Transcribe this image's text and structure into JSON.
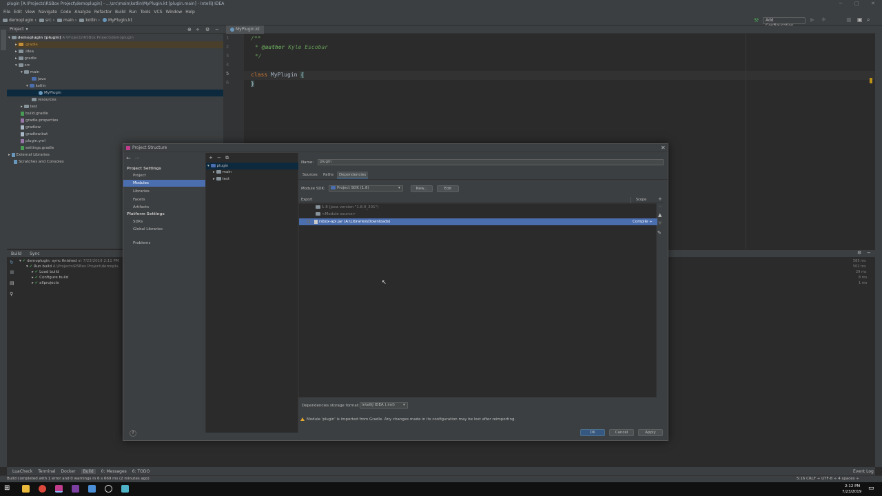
{
  "window": {
    "title": "plugin [A:\\Projects\\RSBox Project\\demoplugin] - ...\\src\\main\\kotlin\\MyPlugin.kt [plugin.main] - IntelliJ IDEA"
  },
  "menu": [
    "File",
    "Edit",
    "View",
    "Navigate",
    "Code",
    "Analyze",
    "Refactor",
    "Build",
    "Run",
    "Tools",
    "VCS",
    "Window",
    "Help"
  ],
  "breadcrumbs": [
    "demoplugin",
    "src",
    "main",
    "kotlin",
    "MyPlugin.kt"
  ],
  "toolbar": {
    "add_config": "Add Configuration..."
  },
  "project_panel": {
    "title": "Project",
    "items": [
      {
        "label": "demoplugin [plugin]",
        "path": "A:\\Projects\\RSBox Project\\demoplugin"
      },
      {
        "label": ".gradle"
      },
      {
        "label": ".idea"
      },
      {
        "label": "gradle"
      },
      {
        "label": "src"
      },
      {
        "label": "main"
      },
      {
        "label": "java"
      },
      {
        "label": "kotlin"
      },
      {
        "label": "MyPlugin"
      },
      {
        "label": "resources"
      },
      {
        "label": "test"
      },
      {
        "label": "build.gradle"
      },
      {
        "label": "gradle.properties"
      },
      {
        "label": "gradlew"
      },
      {
        "label": "gradlew.bat"
      },
      {
        "label": "plugin.yml"
      },
      {
        "label": "settings.gradle"
      },
      {
        "label": "External Libraries"
      },
      {
        "label": "Scratches and Consoles"
      }
    ]
  },
  "editor": {
    "tab": "MyPlugin.kt",
    "lines": [
      "1",
      "2",
      "3",
      "4",
      "5",
      "6"
    ],
    "code": {
      "l1": "/**",
      "l2_tag": "@author",
      "l2_name": "Kyle Escobar",
      "l3": "*/",
      "l5_kw": "class",
      "l5_name": "MyPlugin",
      "l5_brace": "{",
      "l6": "}"
    }
  },
  "build_panel": {
    "tabs": [
      "Build",
      "Sync"
    ],
    "root": "demoplugin: sync finished",
    "root_time": "at 7/23/2019 2:11 PM",
    "run_build": "Run build",
    "run_build_path": "A:\\Projects\\RSBox Project\\demoplu",
    "children": [
      "Load build",
      "Configure build",
      "allprojects"
    ],
    "times": [
      "585 ms",
      "502 ms",
      "29 ms",
      "8 ms",
      "1 ms"
    ]
  },
  "tool_strip": [
    "LuaCheck",
    "Terminal",
    "Docker",
    "Build",
    "0: Messages",
    "6: TODO"
  ],
  "tool_strip_right": "Event Log",
  "status": {
    "message": "Build completed with 1 error and 0 warnings in 6 s 669 ms (2 minutes ago)",
    "right": "5:16  CRLF ÷  UTF-8 ÷  4 spaces ÷"
  },
  "taskbar": {
    "time": "2:12 PM",
    "date": "7/23/2019"
  },
  "dialog": {
    "title": "Project Structure",
    "nav_heads": [
      "Project Settings",
      "Platform Settings"
    ],
    "project_settings": [
      "Project",
      "Modules",
      "Libraries",
      "Facets",
      "Artifacts"
    ],
    "platform_settings": [
      "SDKs",
      "Global Libraries"
    ],
    "problems": "Problems",
    "tree": [
      "plugin",
      "main",
      "test"
    ],
    "name_label": "Name:",
    "name_value": "plugin",
    "tabs": [
      "Sources",
      "Paths",
      "Dependencies"
    ],
    "sdk_label": "Module SDK:",
    "sdk_value": "Project SDK (1.8)",
    "new_btn": "New...",
    "edit_btn": "Edit",
    "col_export": "Export",
    "col_scope": "Scope",
    "deps": [
      "1.8 (java version \"1.8.0_201\")",
      "<Module source>",
      "rsbox-api.jar (A:\\Libraries\\Downloads)"
    ],
    "dep_scope": "Compile ÷",
    "storage_label": "Dependencies storage format:",
    "storage_value": "IntelliJ IDEA (.iml)",
    "warning": "Module 'plugin' is imported from Gradle. Any changes made in its configuration may be lost after reimporting.",
    "help": "?",
    "ok": "OK",
    "cancel": "Cancel",
    "apply": "Apply"
  },
  "colors": {
    "accent": "#4b6eaf",
    "selection": "#0d293e",
    "background": "#2b2b2b",
    "panel": "#3c3f41"
  }
}
